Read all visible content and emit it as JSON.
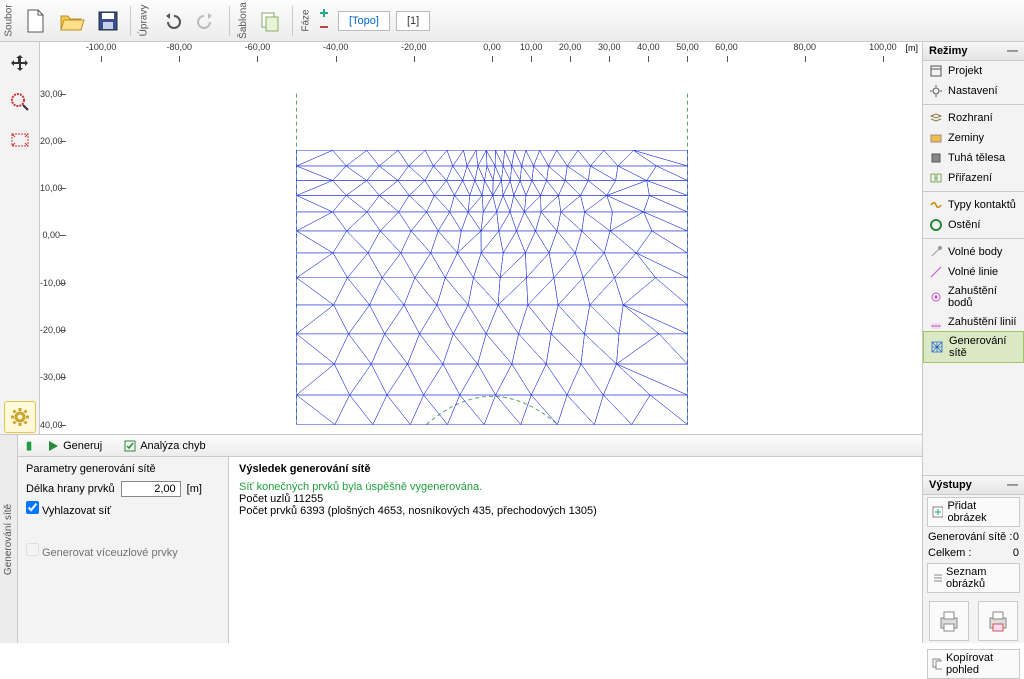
{
  "toolbar": {
    "soubor": "Soubor",
    "upravy": "Úpravy",
    "sablona": "Šablona",
    "faze": "Fáze",
    "phase_topo": "[Topo]",
    "phase_1": "[1]"
  },
  "ruler": {
    "unit": "[m]",
    "x_ticks": [
      "-100,00",
      "-80,00",
      "-60,00",
      "-40,00",
      "-20,00",
      "0,00",
      "10,00",
      "20,00",
      "30,00",
      "40,00",
      "50,00",
      "60,00",
      "80,00",
      "100,00"
    ],
    "x_vals": [
      -100,
      -80,
      -60,
      -40,
      -20,
      0,
      10,
      20,
      30,
      40,
      50,
      60,
      80,
      100
    ],
    "y_ticks": [
      "30,00",
      "20,00",
      "10,00",
      "0,00",
      "-10,00",
      "-20,00",
      "-30,00",
      "40,00"
    ],
    "y_vals": [
      30,
      20,
      10,
      0,
      -10,
      -20,
      -30,
      -40
    ]
  },
  "modes": {
    "title": "Režimy",
    "items": [
      {
        "label": "Projekt",
        "icon": "proj"
      },
      {
        "label": "Nastavení",
        "icon": "gear"
      }
    ],
    "items2": [
      {
        "label": "Rozhraní",
        "icon": "layers"
      },
      {
        "label": "Zeminy",
        "icon": "soil"
      },
      {
        "label": "Tuhá tělesa",
        "icon": "rigid"
      },
      {
        "label": "Přiřazení",
        "icon": "assign"
      }
    ],
    "items3": [
      {
        "label": "Typy kontaktů",
        "icon": "contact"
      },
      {
        "label": "Ostění",
        "icon": "lining"
      }
    ],
    "items4": [
      {
        "label": "Volné body",
        "icon": "fpoint"
      },
      {
        "label": "Volné linie",
        "icon": "fline"
      },
      {
        "label": "Zahuštění bodů",
        "icon": "dpoint"
      },
      {
        "label": "Zahuštění linií",
        "icon": "dline"
      },
      {
        "label": "Generování sítě",
        "icon": "mesh",
        "selected": true
      }
    ]
  },
  "bottom": {
    "tab": "Generování sítě",
    "generuj": "Generuj",
    "analyza": "Analýza chyb",
    "params_title": "Parametry generování sítě",
    "edge_label": "Délka hrany prvků",
    "edge_value": "2,00",
    "edge_unit": "[m]",
    "smooth": "Vyhlazovat síť",
    "multi": "Generovat víceuzlové prvky",
    "result_title": "Výsledek generování sítě",
    "result_success": "Síť konečných prvků byla úspěšně vygenerována.",
    "result_nodes": "Počet uzlů 11255",
    "result_elems": "Počet prvků 6393 (plošných 4653, nosníkových 435, přechodových 1305)"
  },
  "outputs": {
    "title": "Výstupy",
    "add_pic": "Přidat obrázek",
    "gen": "Generování sítě :",
    "gen_n": "0",
    "total": "Celkem :",
    "total_n": "0",
    "list": "Seznam obrázků",
    "copy": "Kopírovat pohled"
  },
  "chart_data": {
    "type": "mesh",
    "title": "Finite element mesh — tunnel cross-section",
    "xlim": [
      -50,
      50
    ],
    "ylim": [
      -40,
      18
    ],
    "tunnel_center": [
      0,
      14
    ],
    "tunnel_radius": 16,
    "nodes": 11255,
    "elements": 6393,
    "element_breakdown": {
      "area": 4653,
      "beam": 435,
      "transition": 1305
    },
    "edge_length": 2.0,
    "units": "m"
  }
}
